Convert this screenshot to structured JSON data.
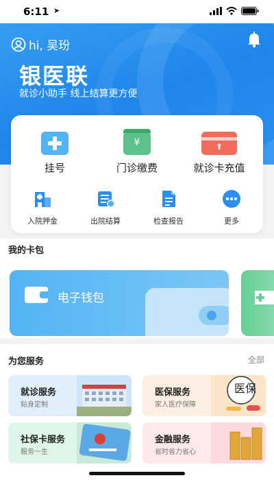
{
  "status": {
    "time": "6:11",
    "location_arrow": "➤"
  },
  "header": {
    "greeting": "hi, 吴玢",
    "title": "银医联",
    "subtitle": "就诊小助手 线上结算更方便",
    "colors": {
      "primary": "#1f86ec",
      "accent_light": "#3aa2f2"
    }
  },
  "main_functions": [
    {
      "label": "挂号",
      "icon": "register-plus-icon",
      "color": "#53b4f4"
    },
    {
      "label": "门诊缴费",
      "icon": "yuan-payment-icon",
      "color": "#5cc18a"
    },
    {
      "label": "就诊卡充值",
      "icon": "card-topup-icon",
      "color": "#f26a5a"
    }
  ],
  "sub_functions": [
    {
      "label": "入院押金",
      "icon": "hospital-building-icon"
    },
    {
      "label": "出院结算",
      "icon": "bill-settle-icon"
    },
    {
      "label": "检查报告",
      "icon": "report-document-icon"
    },
    {
      "label": "更多",
      "icon": "more-dots-icon"
    }
  ],
  "wallet_section": {
    "title": "我的卡包",
    "cards": [
      {
        "label": "电子钱包",
        "icon": "wallet-icon"
      }
    ]
  },
  "services_section": {
    "title": "为您服务",
    "all_label": "全部",
    "items": [
      {
        "title": "就诊服务",
        "subtitle": "贴身定制",
        "bg": "#e1effd"
      },
      {
        "title": "医保服务",
        "subtitle": "家人医疗保障",
        "bg": "#fdf0e2"
      },
      {
        "title": "社保卡服务",
        "subtitle": "服务一生",
        "bg": "#e0f5ea"
      },
      {
        "title": "金融服务",
        "subtitle": "省时省力省心",
        "bg": "#fde8ea"
      }
    ],
    "stamp_text": "医保"
  }
}
